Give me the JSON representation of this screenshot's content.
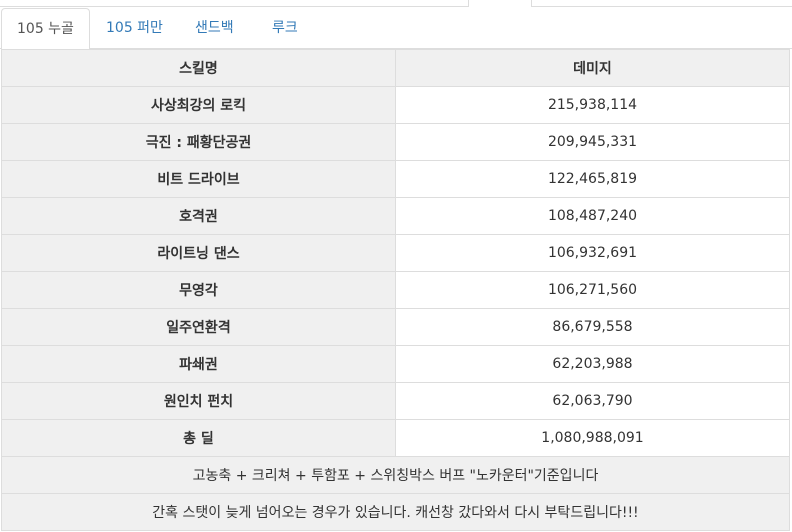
{
  "tabs": [
    {
      "label": "105 누골",
      "active": true
    },
    {
      "label": "105 퍼만",
      "active": false
    },
    {
      "label": "샌드백",
      "active": false
    },
    {
      "label": "루크",
      "active": false
    }
  ],
  "table": {
    "headers": [
      "스킬명",
      "데미지"
    ],
    "rows": [
      {
        "skill": "사상최강의 로킥",
        "damage": "215,938,114"
      },
      {
        "skill": "극진 : 패황단공권",
        "damage": "209,945,331"
      },
      {
        "skill": "비트 드라이브",
        "damage": "122,465,819"
      },
      {
        "skill": "호격권",
        "damage": "108,487,240"
      },
      {
        "skill": "라이트닝 댄스",
        "damage": "106,932,691"
      },
      {
        "skill": "무영각",
        "damage": "106,271,560"
      },
      {
        "skill": "일주연환격",
        "damage": "86,679,558"
      },
      {
        "skill": "파쇄권",
        "damage": "62,203,988"
      },
      {
        "skill": "원인치 펀치",
        "damage": "62,063,790"
      }
    ],
    "total": {
      "label": "총 딜",
      "damage": "1,080,988,091"
    },
    "notes": [
      "고농축 + 크리쳐 + 투함포 + 스위칭박스 버프 \"노카운터\"기준입니다",
      "간혹 스탯이 늦게 넘어오는 경우가 있습니다. 캐선창 갔다와서 다시 부탁드립니다!!!"
    ]
  }
}
